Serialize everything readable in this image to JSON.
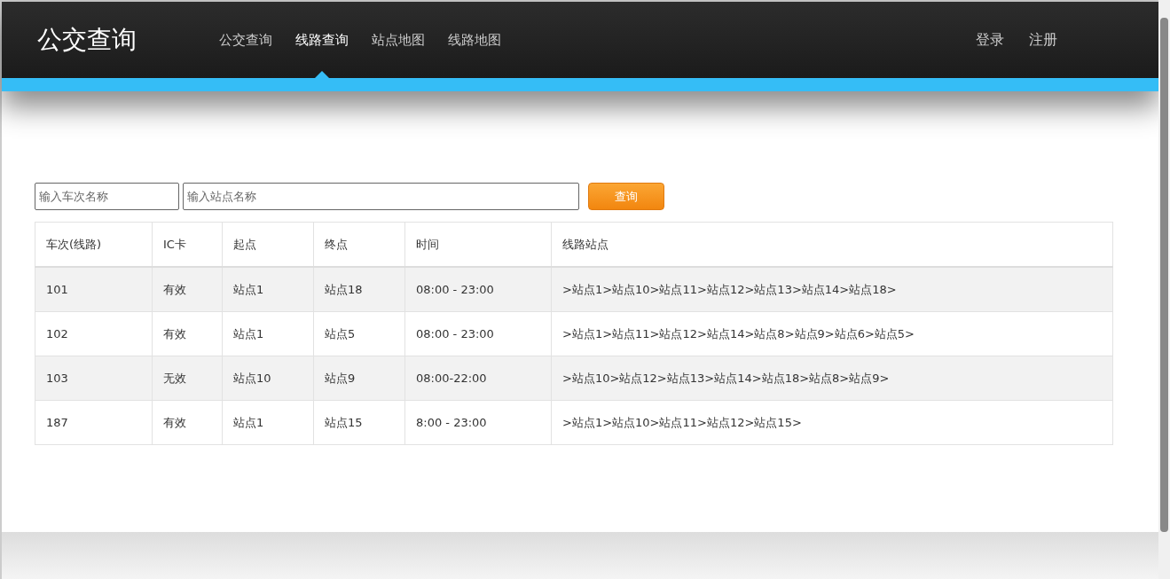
{
  "header": {
    "brand": "公交查询",
    "nav": [
      {
        "label": "公交查询",
        "selected": false
      },
      {
        "label": "线路查询",
        "selected": true
      },
      {
        "label": "站点地图",
        "selected": false
      },
      {
        "label": "线路地图",
        "selected": false
      }
    ],
    "account_links": [
      "登录",
      "注册"
    ]
  },
  "search": {
    "route_placeholder": "输入车次名称",
    "station_placeholder": "输入站点名称",
    "button": "查询"
  },
  "table": {
    "columns": [
      "车次(线路)",
      "IC卡",
      "起点",
      "终点",
      "时间",
      "线路站点"
    ],
    "rows": [
      [
        "101",
        "有效",
        "站点1",
        "站点18",
        "08:00 - 23:00",
        ">站点1>站点10>站点11>站点12>站点13>站点14>站点18>"
      ],
      [
        "102",
        "有效",
        "站点1",
        "站点5",
        "08:00 - 23:00",
        ">站点1>站点11>站点12>站点14>站点8>站点9>站点6>站点5>"
      ],
      [
        "103",
        "无效",
        "站点10",
        "站点9",
        "08:00-22:00",
        ">站点10>站点12>站点13>站点14>站点18>站点8>站点9>"
      ],
      [
        "187",
        "有效",
        "站点1",
        "站点15",
        "8:00 - 23:00",
        ">站点1>站点10>站点11>站点12>站点15>"
      ]
    ]
  }
}
